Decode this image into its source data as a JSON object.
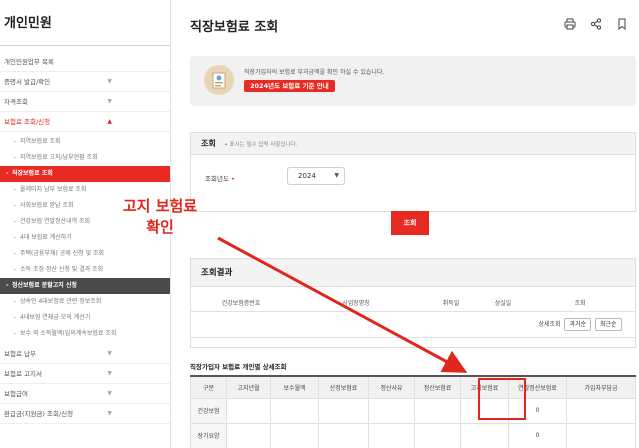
{
  "sidebar": {
    "title": "개인민원",
    "items": [
      {
        "label": "개인민원업무 목록",
        "chev": ""
      },
      {
        "label": "증명서 발급/확인",
        "chev": "▼"
      },
      {
        "label": "자격조회",
        "chev": "▼"
      },
      {
        "label": "보험료 조회/신청",
        "chev": "▲"
      }
    ],
    "sub_items": [
      {
        "label": "지역보험료 조회"
      },
      {
        "label": "지역보험료 고지/납부현황 조회"
      },
      {
        "label": "직장보험료 조회"
      },
      {
        "label": "올레미지 납부 보험료 조회"
      },
      {
        "label": "사회보험료 완납 조회"
      },
      {
        "label": "건강보험 연말정산내역 조회"
      },
      {
        "label": "4대 보험료 계산하기"
      },
      {
        "label": "주택(금융부채) 공제 신청 및 조회"
      },
      {
        "label": "소득 조정·정산 신청 및 결과 조회"
      },
      {
        "label": "정산보험료 분할고지 신청"
      },
      {
        "label": "상속인 4대보험료 관련 정보조회"
      },
      {
        "label": "4대보험 연체금 모의 계산기"
      },
      {
        "label": "보수 외 소득월액(임의계속보험료 조회"
      }
    ],
    "bottom_items": [
      {
        "label": "보험료 납부",
        "chev": "▼"
      },
      {
        "label": "보험료 고지서",
        "chev": "▼"
      },
      {
        "label": "보험급여",
        "chev": "▼"
      },
      {
        "label": "환급금(지원금) 조회/신청",
        "chev": "▼"
      }
    ]
  },
  "main": {
    "title": "직장보험료 조회",
    "toolbar": {
      "print_icon": "printer-icon",
      "share_icon": "share-icon",
      "bookmark_icon": "bookmark-icon"
    },
    "info": {
      "text": "직장가입자의 보험료 부과금액을 확인 하실 수 있습니다.",
      "button": "2024년도 보험료 기준 안내"
    },
    "query": {
      "heading": "조회",
      "required_note": "표시는 필수 입력 사항입니다.",
      "year_label": "조회년도",
      "year_value": "2024",
      "search_button": "조회"
    },
    "result": {
      "heading": "조회결과",
      "columns": [
        "건강보험증번호",
        "사업장명칭",
        "취득일",
        "상실일",
        "조회"
      ],
      "row": {
        "detail_label": "상세조회",
        "btn_past": "과거순",
        "btn_recent": "최근순"
      }
    },
    "detail": {
      "title": "직장가입자 보험료 개인별 상세조회",
      "columns": [
        "구분",
        "고지년월",
        "보수월액",
        "산정보험료",
        "정산사유",
        "정산보험료",
        "고지보험료",
        "연말정산보험료",
        "가입자부담금"
      ],
      "rows": [
        {
          "label": "건강보험",
          "year_end": "0"
        },
        {
          "label": "장기요양",
          "year_end": "0"
        }
      ]
    }
  },
  "annotation": {
    "line1": "고지 보험료",
    "line2": "확인",
    "color": "#e0261d"
  }
}
